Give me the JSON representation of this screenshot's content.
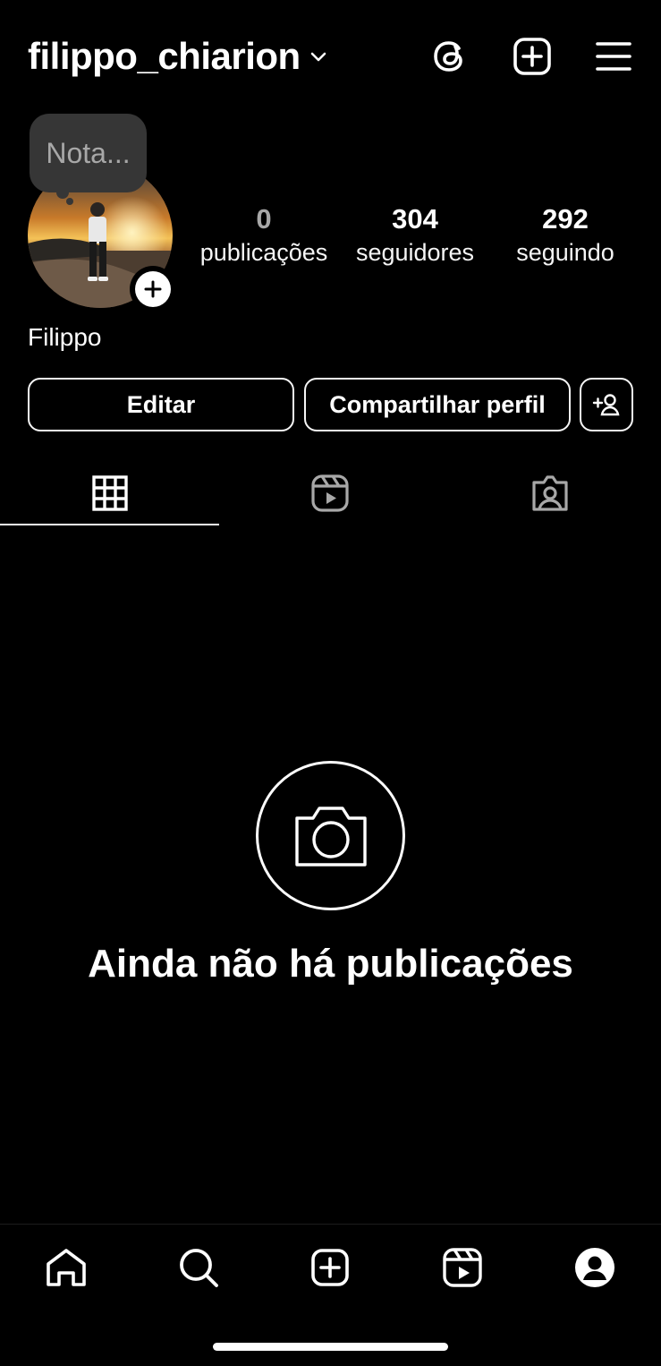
{
  "header": {
    "username": "filippo_chiarion",
    "icons": [
      "threads-icon",
      "create-icon",
      "menu-icon"
    ]
  },
  "profile": {
    "note_placeholder": "Nota...",
    "display_name": "Filippo",
    "stats": [
      {
        "value": "0",
        "label": "publicações"
      },
      {
        "value": "304",
        "label": "seguidores"
      },
      {
        "value": "292",
        "label": "seguindo"
      }
    ]
  },
  "actions": {
    "edit_label": "Editar",
    "share_label": "Compartilhar perfil"
  },
  "tabs": {
    "items": [
      "grid-icon",
      "reels-icon",
      "tagged-icon"
    ],
    "active": "grid-icon"
  },
  "empty_state": {
    "title": "Ainda não há publicações"
  },
  "bottom_nav": {
    "items": [
      "home-icon",
      "search-icon",
      "create-icon",
      "reels-icon",
      "profile-icon"
    ],
    "active": "profile-icon"
  },
  "colors": {
    "background": "#000000",
    "text": "#ffffff",
    "muted": "#a8a8a8",
    "note_bg": "#363636"
  }
}
